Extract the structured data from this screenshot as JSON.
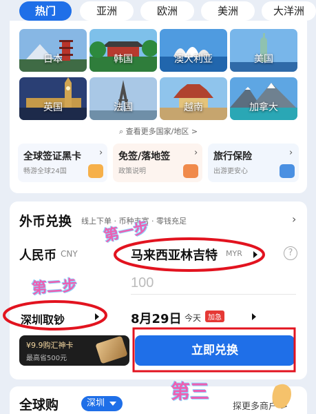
{
  "region_tabs": [
    "热门",
    "亚洲",
    "欧洲",
    "美洲",
    "大洋洲"
  ],
  "destinations": [
    "日本",
    "韩国",
    "澳大利亚",
    "美国",
    "英国",
    "法国",
    "越南",
    "加拿大"
  ],
  "more_countries": "查看更多国家/地区 >",
  "services": [
    {
      "title": "全球签证黑卡",
      "subtitle": "畅游全球24国"
    },
    {
      "title": "免签/落地签",
      "subtitle": "政策说明"
    },
    {
      "title": "旅行保险",
      "subtitle": "出游更安心"
    }
  ],
  "exchange": {
    "title": "外币兑换",
    "subtitle": "线上下单 · 币种丰富 · 零钱充足",
    "from_currency": "人民币",
    "from_code": "CNY",
    "to_currency": "马来西亚林吉特",
    "to_code": "MYR",
    "amount_placeholder": "100",
    "pickup_city": "深圳取钞",
    "date": "8月29日",
    "date_note": "今天",
    "urgent_badge": "加急",
    "promo_line1": "¥9.9购汇神卡",
    "promo_line2": "最高省500元",
    "submit_label": "立即兑换"
  },
  "global_shop": {
    "title": "全球购",
    "city": "深圳",
    "more_shops": "探更多商户 >"
  },
  "annotations": {
    "step1": "第一步",
    "step2": "第二步",
    "step3": "第三"
  },
  "colors": {
    "accent": "#1f6fe8",
    "annotation_circle": "#e2131f",
    "annotation_text": "#ec5fb1"
  }
}
